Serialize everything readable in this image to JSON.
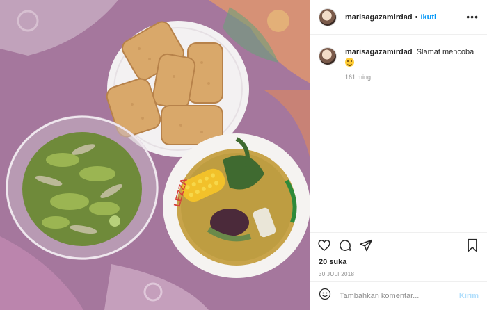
{
  "post": {
    "username": "marisagazamirdad",
    "follow_label": "Ikuti",
    "separator": "•",
    "more_label": "•••",
    "caption_user": "marisagazamirdad",
    "caption_text": "Slamat mencoba",
    "caption_time": "161 ming",
    "likes": "20 suka",
    "date": "30 JULI 2018",
    "comment_placeholder": "Tambahkan komentar...",
    "post_label": "Kirim",
    "bowl_label": "LEZZA"
  },
  "icons": [
    "heart-icon",
    "comment-icon",
    "share-icon",
    "bookmark-icon",
    "smile-icon"
  ],
  "colors": {
    "link": "#0095f6",
    "muted": "#8e8e8e",
    "post_disabled": "#b2dffc"
  }
}
